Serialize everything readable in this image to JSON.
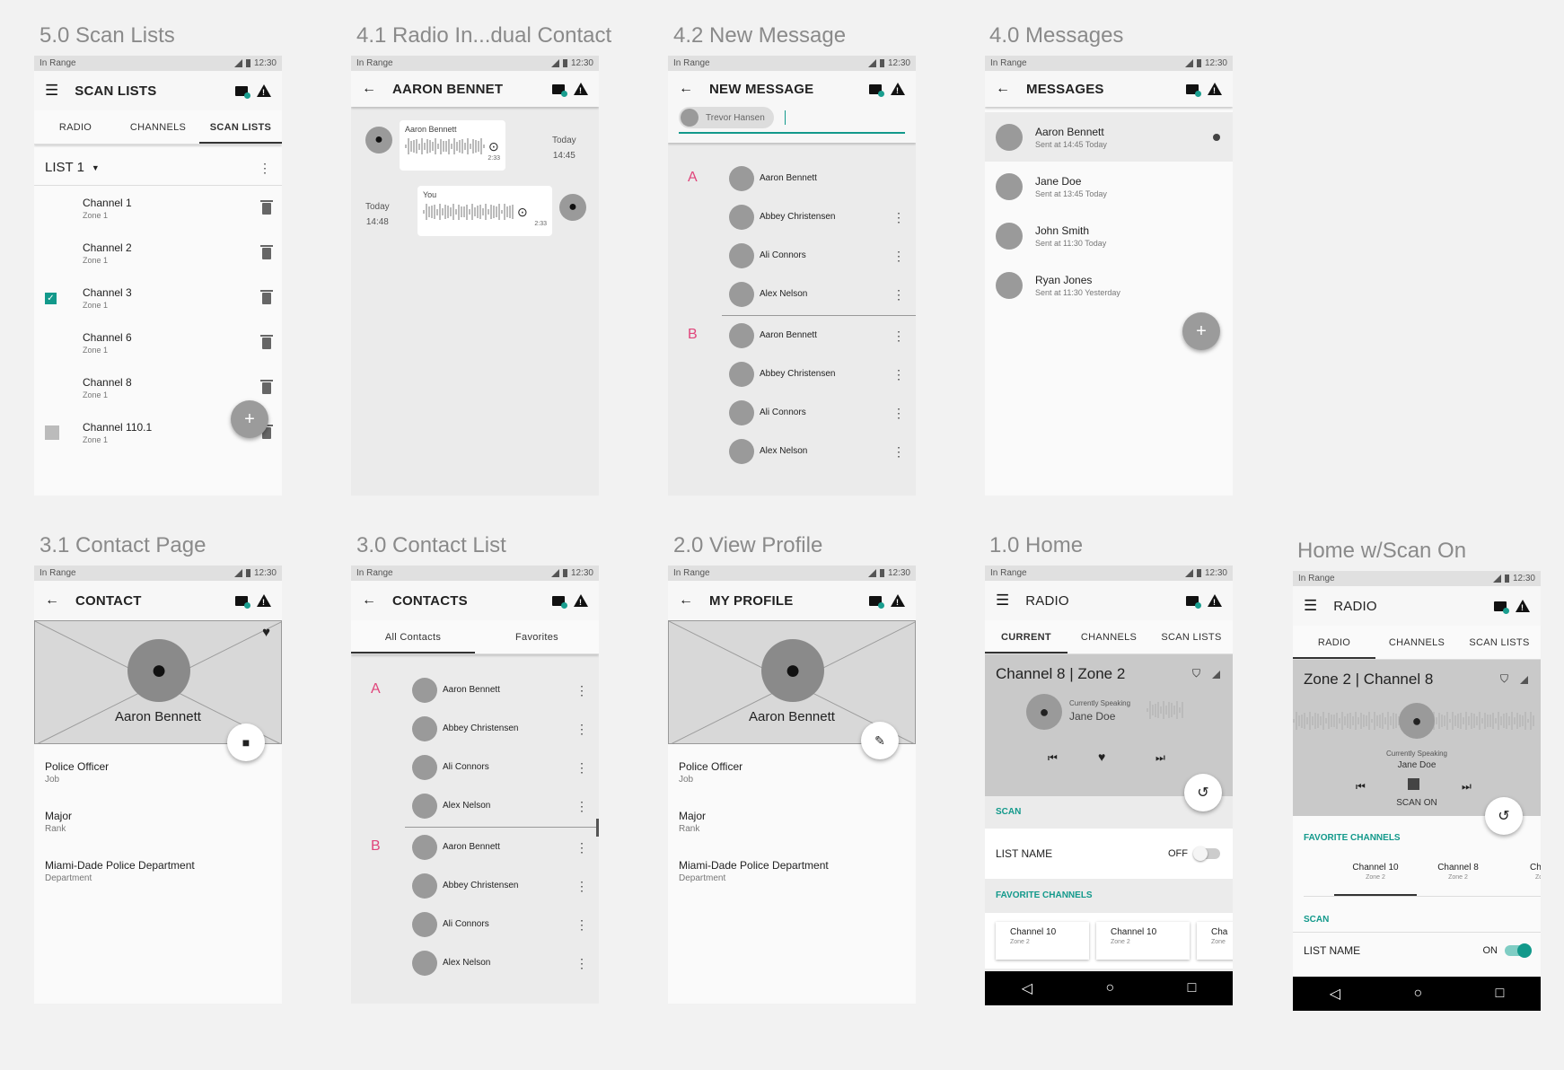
{
  "status": {
    "left": "In Range",
    "time": "12:30"
  },
  "labels": {
    "scan_lists": "5.0 Scan Lists",
    "radio_individual": "4.1 Radio In...dual Contact",
    "new_message": "4.2 New Message",
    "messages": "4.0 Messages",
    "contact_page": "3.1 Contact Page",
    "contact_list": "3.0 Contact List",
    "view_profile": "2.0 View Profile",
    "home": "1.0 Home",
    "home_scan": "Home w/Scan On"
  },
  "scan": {
    "title": "SCAN LISTS",
    "tabs": [
      "RADIO",
      "CHANNELS",
      "SCAN LISTS"
    ],
    "list": "LIST 1",
    "items": [
      {
        "name": "Channel 1",
        "zone": "Zone 1",
        "checked": false
      },
      {
        "name": "Channel 2",
        "zone": "Zone 1",
        "checked": false
      },
      {
        "name": "Channel 3",
        "zone": "Zone 1",
        "checked": true
      },
      {
        "name": "Channel 6",
        "zone": "Zone 1",
        "checked": false
      },
      {
        "name": "Channel 8",
        "zone": "Zone 1",
        "checked": false
      },
      {
        "name": "Channel 110.1",
        "zone": "Zone 1",
        "checked": false,
        "grey": true
      }
    ],
    "fab": "+"
  },
  "radioind": {
    "title": "AARON BENNET",
    "m1": {
      "sender": "Aaron Bennett",
      "duration": "2:33",
      "day": "Today",
      "time": "14:45"
    },
    "m2": {
      "sender": "You",
      "duration": "2:33",
      "day": "Today",
      "time": "14:48"
    }
  },
  "newmsg": {
    "title": "NEW MESSAGE",
    "chip": "Trevor Hansen",
    "sections": [
      {
        "letter": "A",
        "names": [
          "Aaron Bennett",
          "Abbey Christensen",
          "Ali Connors",
          "Alex Nelson"
        ]
      },
      {
        "letter": "B",
        "names": [
          "Aaron Bennett",
          "Abbey Christensen",
          "Ali Connors",
          "Alex Nelson"
        ]
      }
    ]
  },
  "messages": {
    "title": "MESSAGES",
    "items": [
      {
        "name": "Aaron Bennett",
        "sub": "Sent at 14:45 Today"
      },
      {
        "name": "Jane Doe",
        "sub": "Sent at 13:45 Today"
      },
      {
        "name": "John Smith",
        "sub": "Sent at 11:30 Today"
      },
      {
        "name": "Ryan Jones",
        "sub": "Sent at 11:30 Yesterday"
      }
    ],
    "fab": "+"
  },
  "contact": {
    "title": "CONTACT",
    "name": "Aaron Bennett",
    "fields": [
      {
        "v": "Police Officer",
        "k": "Job"
      },
      {
        "v": "Major",
        "k": "Rank"
      },
      {
        "v": "Miami-Dade Police Department",
        "k": "Department"
      }
    ]
  },
  "contacts": {
    "title": "CONTACTS",
    "tabs": [
      "All Contacts",
      "Favorites"
    ],
    "sections": [
      {
        "letter": "A",
        "names": [
          "Aaron Bennett",
          "Abbey Christensen",
          "Ali Connors",
          "Alex Nelson"
        ]
      },
      {
        "letter": "B",
        "names": [
          "Aaron Bennett",
          "Abbey Christensen",
          "Ali Connors",
          "Alex Nelson"
        ]
      }
    ]
  },
  "profile": {
    "title": "MY PROFILE",
    "name": "Aaron Bennett",
    "fields": [
      {
        "v": "Police Officer",
        "k": "Job"
      },
      {
        "v": "Major",
        "k": "Rank"
      },
      {
        "v": "Miami-Dade Police Department",
        "k": "Department"
      }
    ]
  },
  "home": {
    "title": "RADIO",
    "tabs": [
      "CURRENT",
      "CHANNELS",
      "SCAN LISTS"
    ],
    "channel": "Channel 8 | Zone 2",
    "speaking_label": "Currently Speaking",
    "speaker": "Jane Doe",
    "scan_header": "SCAN",
    "list_name": "LIST NAME",
    "toggle": "OFF",
    "fav_header": "FAVORITE CHANNELS",
    "favs": [
      {
        "name": "Channel 10",
        "zone": "Zone 2"
      },
      {
        "name": "Channel 10",
        "zone": "Zone 2"
      },
      {
        "name": "Cha",
        "zone": "Zone"
      }
    ]
  },
  "homescan": {
    "title": "RADIO",
    "tabs": [
      "RADIO",
      "CHANNELS",
      "SCAN LISTS"
    ],
    "channel": "Zone 2 | Channel 8",
    "speaking_label": "Currently Speaking",
    "speaker": "Jane Doe",
    "scan_on": "SCAN ON",
    "fav_header": "FAVORITE CHANNELS",
    "favs": [
      {
        "name": "Channel 10",
        "zone": "Zone 2"
      },
      {
        "name": "Channel 8",
        "zone": "Zone 2"
      },
      {
        "name": "Chan",
        "zone": "Zon"
      }
    ],
    "scan_header": "SCAN",
    "list_name": "LIST NAME",
    "toggle": "ON"
  },
  "colors": {
    "accent": "#12998b",
    "letter": "#e0457b"
  },
  "icons": [
    "menu-icon",
    "back-icon",
    "message-alert-icon",
    "warning-icon",
    "trash-icon",
    "more-vert-icon",
    "play-icon",
    "person-icon",
    "heart-icon",
    "chat-icon",
    "edit-icon",
    "history-icon",
    "skip-prev-icon",
    "skip-next-icon",
    "stop-icon",
    "shield-icon",
    "signal-icon"
  ]
}
